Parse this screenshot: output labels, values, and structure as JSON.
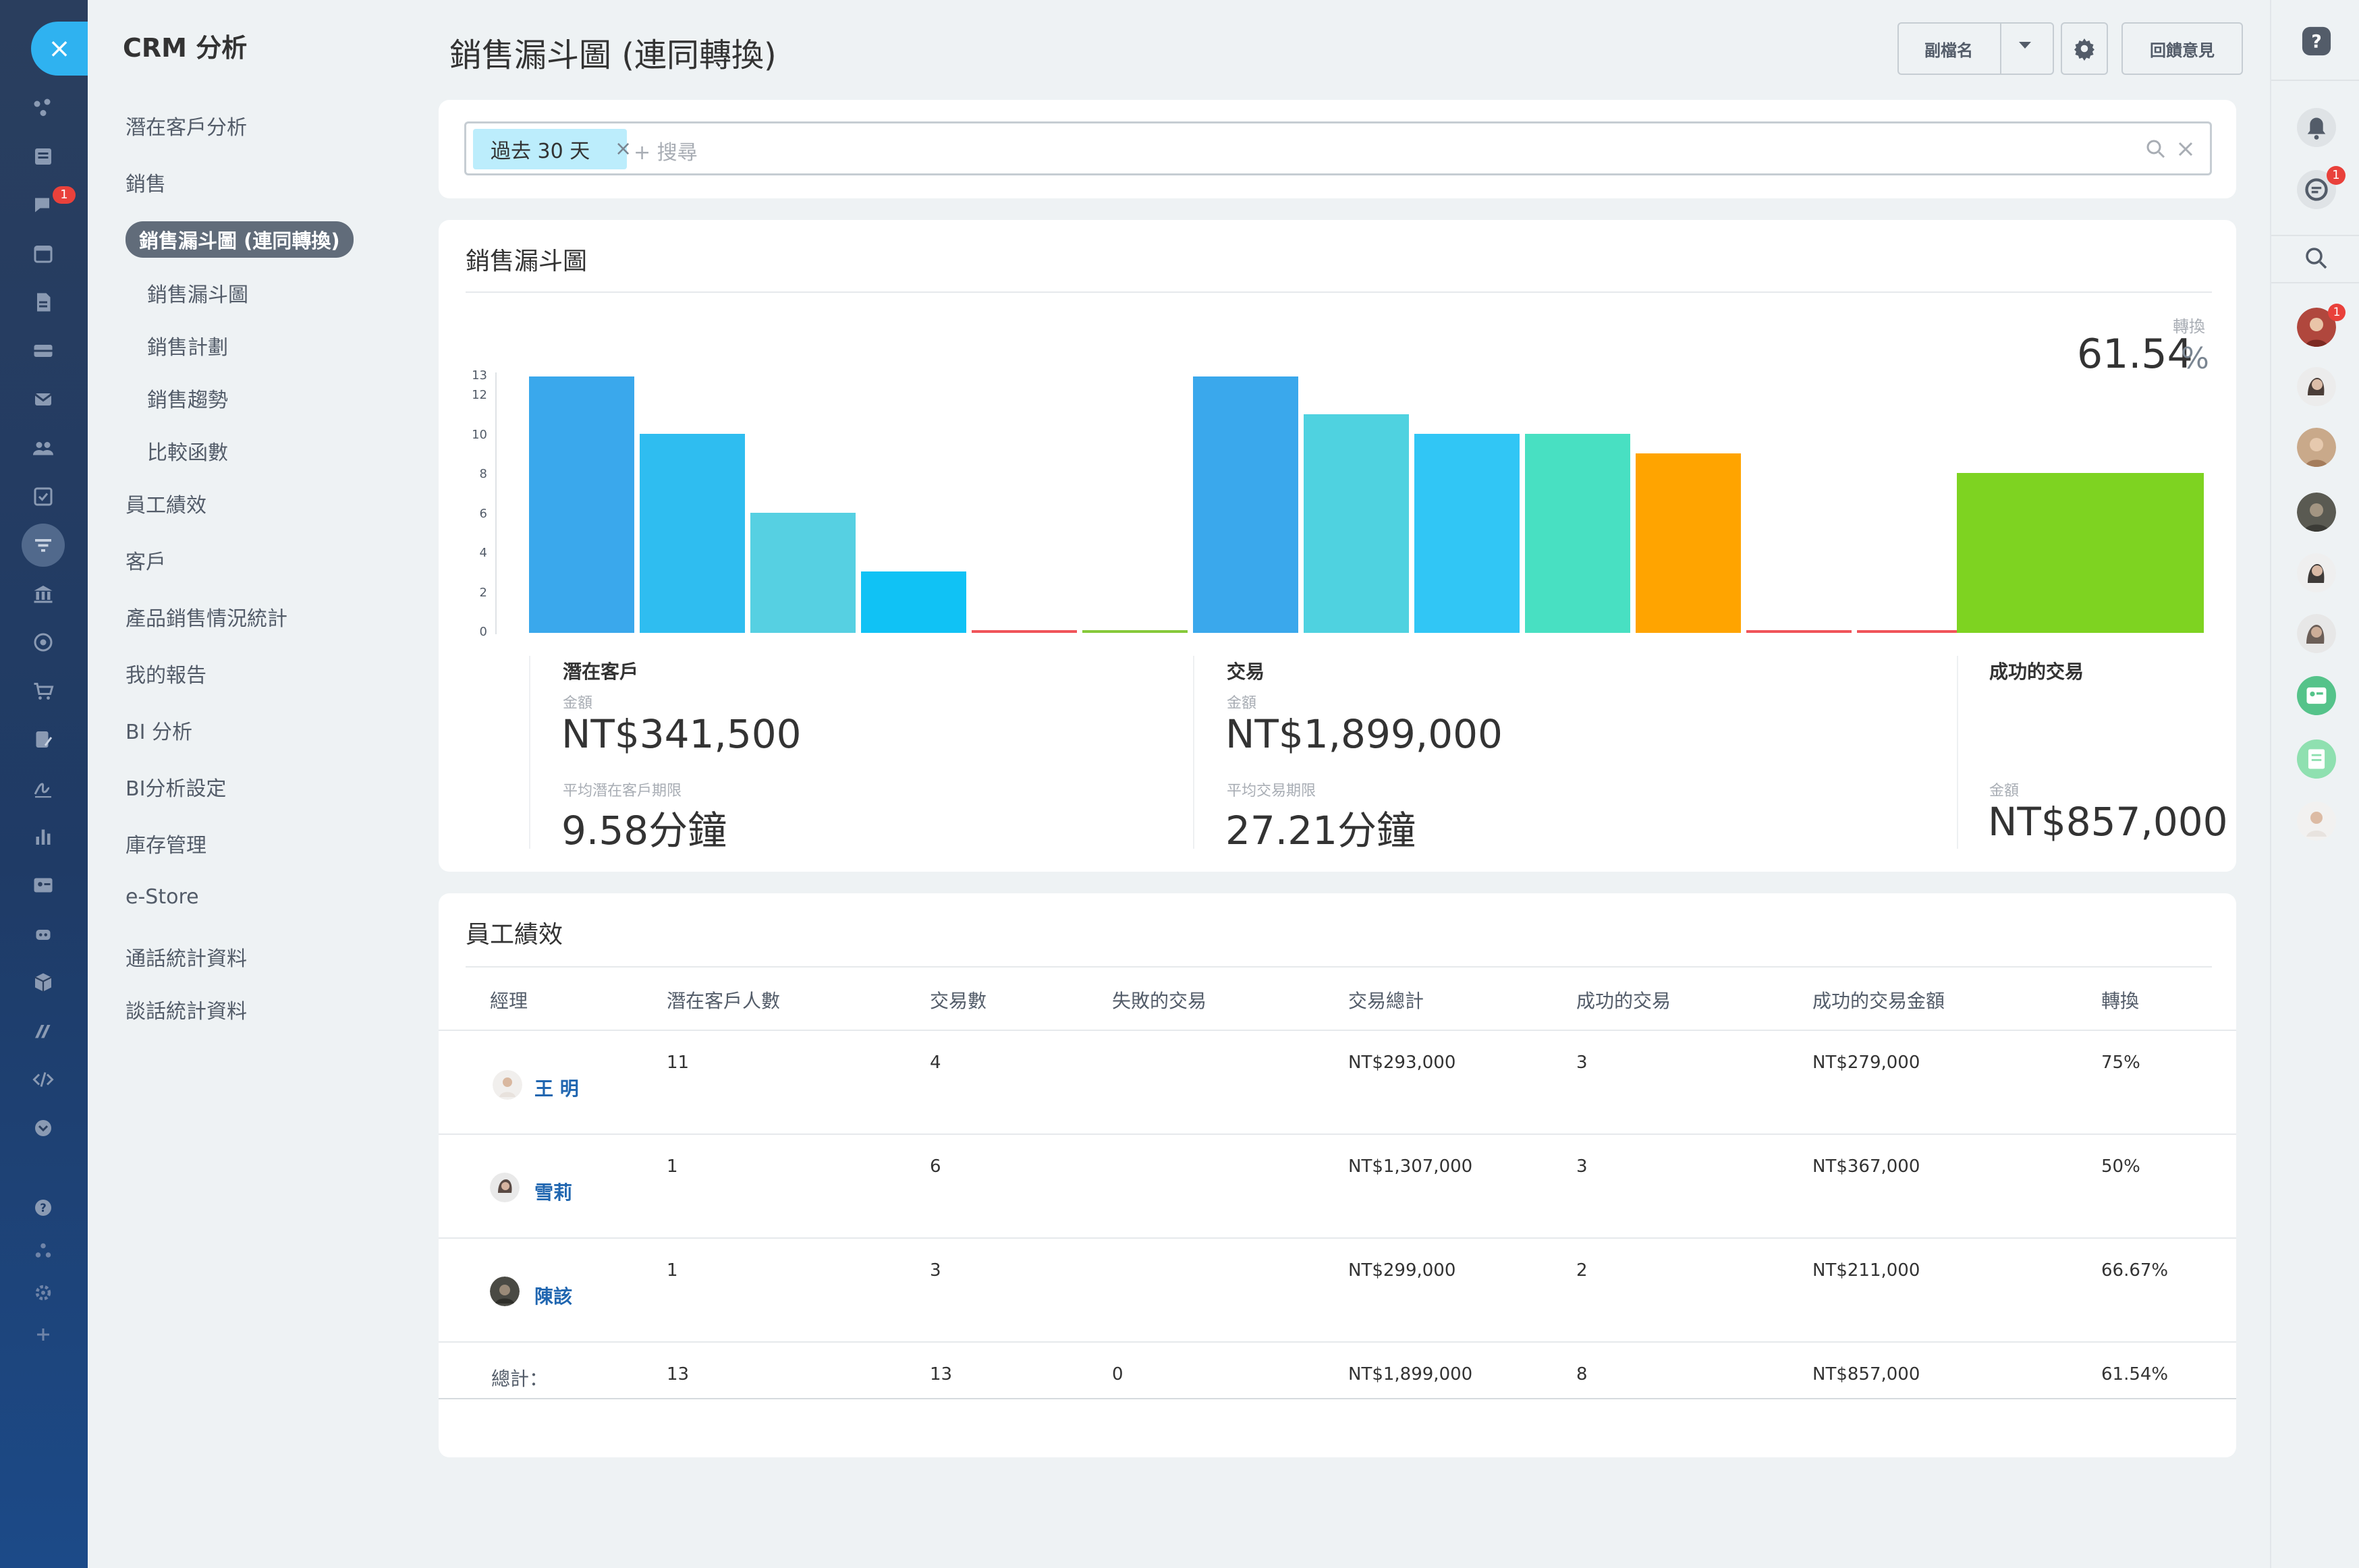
{
  "rail": {
    "close_glyph": "×",
    "icons": [
      "sitemap-icon",
      "newspaper-icon",
      "chat-icon",
      "calendar-icon",
      "document-icon",
      "inbox-icon",
      "mail-icon",
      "users-icon",
      "task-icon",
      "funnel-icon",
      "bank-icon",
      "target-icon",
      "cart-icon",
      "form-icon",
      "sign-icon",
      "bar-chart-icon",
      "contact-card-icon",
      "robot-icon",
      "box-icon",
      "brand-icon",
      "code-icon",
      "chevron-down-circle-icon",
      "help-icon",
      "network-icon",
      "settings-icon",
      "plus-icon"
    ],
    "chat_badge": "1"
  },
  "menu": {
    "title": "CRM 分析",
    "items": [
      {
        "label": "潛在客戶分析"
      },
      {
        "label": "銷售"
      },
      {
        "label": "銷售漏斗圖 (連同轉換)"
      },
      {
        "label": "銷售漏斗圖"
      },
      {
        "label": "銷售計劃"
      },
      {
        "label": "銷售趨勢"
      },
      {
        "label": "比較函數"
      },
      {
        "label": "員工績效"
      },
      {
        "label": "客戶"
      },
      {
        "label": "產品銷售情況統計"
      },
      {
        "label": "我的報告"
      },
      {
        "label": "BI 分析"
      },
      {
        "label": "BI分析設定"
      },
      {
        "label": "庫存管理"
      },
      {
        "label": "e-Store"
      },
      {
        "label": "通話統計資料"
      },
      {
        "label": "談話統計資料"
      }
    ]
  },
  "header": {
    "title": "銷售漏斗圖 (連同轉換)",
    "alias_label": "副檔名",
    "feedback_label": "回饋意見"
  },
  "filter": {
    "chip_label": "過去 30 天",
    "placeholder": "+ 搜尋"
  },
  "funnel": {
    "title": "銷售漏斗圖",
    "conversion_label": "轉換",
    "conversion_value": "61.54",
    "conversion_unit": "%",
    "y_ticks": [
      "13",
      "12",
      "10",
      "8",
      "6",
      "4",
      "2",
      "0"
    ],
    "leads": {
      "label": "潛在客戶",
      "amount_label": "金額",
      "amount": "NT$341,500",
      "avg_label": "平均潛在客戶期限",
      "avg": "9.58分鐘"
    },
    "deals": {
      "label": "交易",
      "amount_label": "金額",
      "amount": "NT$1,899,000",
      "avg_label": "平均交易期限",
      "avg": "27.21分鐘"
    },
    "won": {
      "label": "成功的交易",
      "amount_label": "金額",
      "amount": "NT$857,000"
    }
  },
  "chart_data": {
    "type": "bar",
    "ylim": [
      0,
      13
    ],
    "groups": [
      {
        "name": "潛在客戶",
        "values": [
          13,
          10.1,
          6.1,
          3.1,
          0,
          0
        ],
        "colors": [
          "#3aa8ec",
          "#2fbdf0",
          "#56d0e2",
          "#10c2f5",
          "#f0545a",
          "#86c93a"
        ]
      },
      {
        "name": "交易",
        "values": [
          13,
          11.1,
          10.1,
          10.1,
          9.1,
          0,
          0
        ],
        "colors": [
          "#3aa8ec",
          "#4fd2e0",
          "#31c6f5",
          "#48e0c2",
          "#ffa400",
          "#f0545a",
          "#f0545a"
        ]
      },
      {
        "name": "成功的交易",
        "values": [
          8.1
        ],
        "colors": [
          "#7ed321"
        ]
      }
    ]
  },
  "performance": {
    "title": "員工績效",
    "columns": [
      "經理",
      "潛在客戶人數",
      "交易數",
      "失敗的交易",
      "交易總計",
      "成功的交易",
      "成功的交易金額",
      "轉換"
    ],
    "rows": [
      {
        "name": "王 明",
        "leads": "11",
        "deals": "4",
        "failed": "",
        "total": "NT$293,000",
        "won": "3",
        "won_amount": "NT$279,000",
        "conv": "75%"
      },
      {
        "name": "雪莉",
        "leads": "1",
        "deals": "6",
        "failed": "",
        "total": "NT$1,307,000",
        "won": "3",
        "won_amount": "NT$367,000",
        "conv": "50%"
      },
      {
        "name": "陳該",
        "leads": "1",
        "deals": "3",
        "failed": "",
        "total": "NT$299,000",
        "won": "2",
        "won_amount": "NT$211,000",
        "conv": "66.67%"
      }
    ],
    "total": {
      "label": "總計：",
      "leads": "13",
      "deals": "13",
      "failed": "0",
      "total": "NT$1,899,000",
      "won": "8",
      "won_amount": "NT$857,000",
      "conv": "61.54%"
    }
  },
  "right_panel": {
    "icons": [
      "help-icon",
      "bell-icon",
      "chat-icon",
      "search-icon"
    ],
    "chat_badge": "1",
    "avatar_badge": "1"
  }
}
